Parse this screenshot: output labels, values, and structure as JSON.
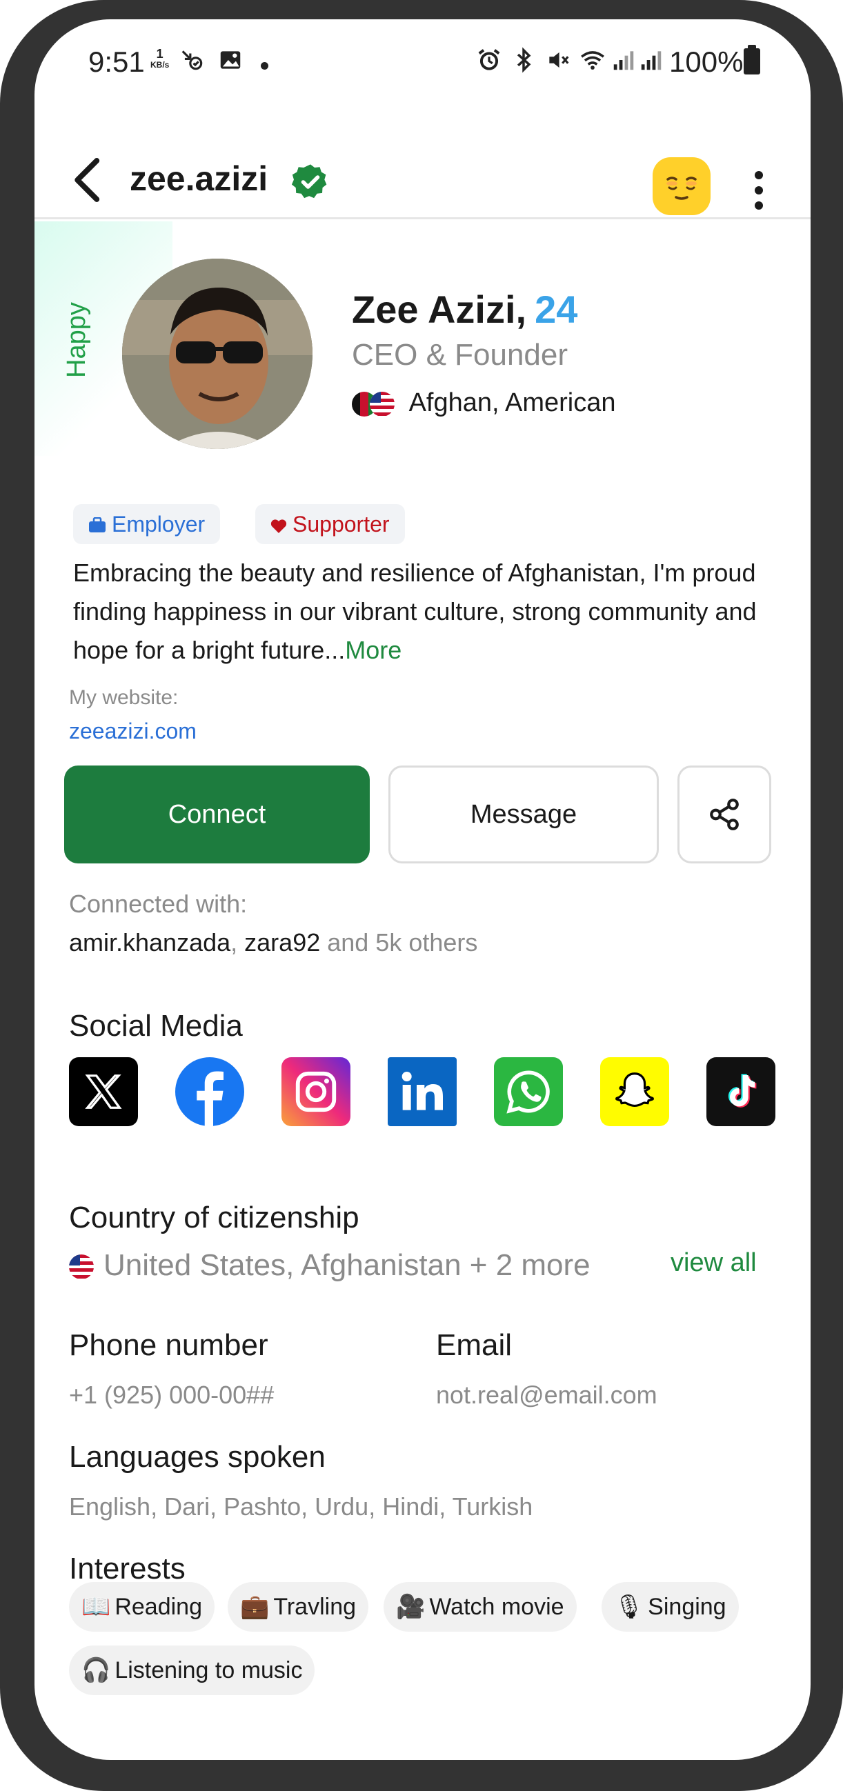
{
  "status_bar": {
    "time": "9:51",
    "net_speed_value": "1",
    "net_speed_unit": "KB/s",
    "battery": "100%"
  },
  "header": {
    "username": "zee.azizi",
    "icons": [
      "back-arrow-icon",
      "verified-badge-icon",
      "mood-emoji-icon",
      "more-vertical-icon"
    ]
  },
  "profile": {
    "mood": "Happy",
    "name": "Zee Azizi,",
    "age": "24",
    "job": "CEO & Founder",
    "nationality": "Afghan, American",
    "badges": [
      {
        "label": "Employer",
        "icon": "briefcase-icon",
        "color": "#2a6fd6"
      },
      {
        "label": "Supporter",
        "icon": "heart-icon",
        "color": "#c2121b"
      }
    ],
    "bio": "Embracing the beauty and resilience of Afghanistan, I'm proud finding happiness in our vibrant culture, strong community and hope for a bright future...",
    "bio_more": "More",
    "website_label": "My website:",
    "website": "zeeazizi.com"
  },
  "actions": {
    "connect": "Connect",
    "message": "Message"
  },
  "connections": {
    "label": "Connected with:",
    "user1": "amir.khanzada",
    "separator": ", ",
    "user2": "zara92",
    "others": " and 5k others"
  },
  "social_media": {
    "title": "Social Media",
    "items": [
      "x-icon",
      "facebook-icon",
      "instagram-icon",
      "linkedin-icon",
      "whatsapp-icon",
      "snapchat-icon",
      "tiktok-icon"
    ]
  },
  "citizenship": {
    "title": "Country of citizenship",
    "value": "United States, Afghanistan + 2 more",
    "view_all": "view all"
  },
  "contact": {
    "phone_label": "Phone number",
    "phone": "+1 (925) 000-00##",
    "email_label": "Email",
    "email": "not.real@email.com"
  },
  "languages": {
    "title": "Languages spoken",
    "value": "English, Dari, Pashto, Urdu, Hindi, Turkish"
  },
  "interests": {
    "title": "Interests",
    "items": [
      {
        "icon": "📖",
        "label": "Reading"
      },
      {
        "icon": "💼",
        "label": "Travling"
      },
      {
        "icon": "🎥",
        "label": "Watch movie"
      },
      {
        "icon": "🎙",
        "label": "Singing"
      },
      {
        "icon": "🎧",
        "label": "Listening to music"
      }
    ]
  },
  "colors": {
    "brand_green": "#1d7c3e",
    "link_blue": "#2a6fd6",
    "age_blue": "#3aa3e8",
    "frame": "#333333"
  }
}
